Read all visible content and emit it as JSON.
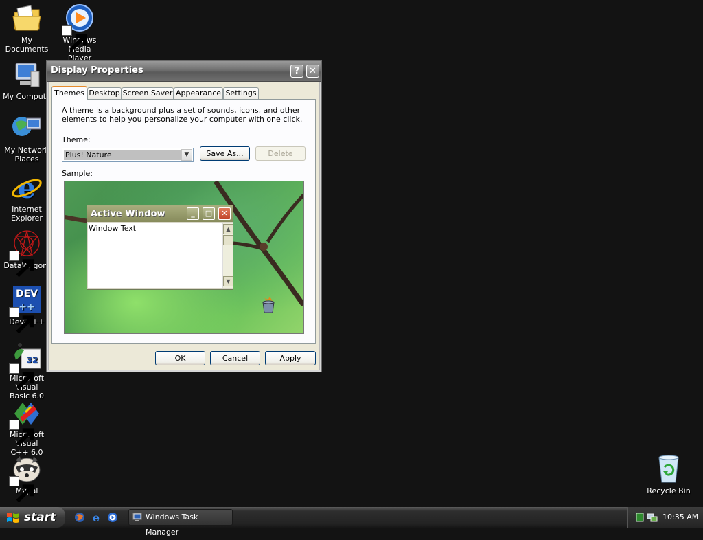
{
  "desktop": {
    "icons": [
      {
        "label": "My Documents",
        "icon": "my-documents-icon"
      },
      {
        "label": "Windows Media\nPlayer",
        "icon": "windows-media-player-icon"
      },
      {
        "label": "My Compute",
        "icon": "my-computer-icon"
      },
      {
        "label": "My Network\nPlaces",
        "icon": "my-network-places-icon"
      },
      {
        "label": "Internet\nExplorer",
        "icon": "internet-explorer-icon"
      },
      {
        "label": "DataWagon.",
        "icon": "datawagon-icon"
      },
      {
        "label": "Dev-C++",
        "icon": "dev-cpp-icon"
      },
      {
        "label": "Microsoft Visual\nBasic 6.0",
        "icon": "visual-basic-icon"
      },
      {
        "label": "Microsoft Visual\nC++ 6.0",
        "icon": "visual-cpp-icon"
      },
      {
        "label": "Mypal",
        "icon": "mypal-icon"
      },
      {
        "label": "Recycle Bin",
        "icon": "recycle-bin-icon"
      }
    ]
  },
  "dialog": {
    "title": "Display Properties",
    "help_label": "?",
    "close_label": "✕",
    "tabs": [
      "Themes",
      "Desktop",
      "Screen Saver",
      "Appearance",
      "Settings"
    ],
    "active_tab": "Themes",
    "description": "A theme is a background plus a set of sounds, icons, and other elements to help you personalize your computer with one click.",
    "theme_label": "Theme:",
    "theme_value": "Plus! Nature",
    "save_as_label": "Save As...",
    "delete_label": "Delete",
    "sample_label": "Sample:",
    "preview": {
      "window_title": "Active Window",
      "window_text": "Window Text"
    },
    "buttons": {
      "ok": "OK",
      "cancel": "Cancel",
      "apply": "Apply"
    }
  },
  "taskbar": {
    "start_label": "start",
    "quick_launch": [
      "firefox-icon",
      "internet-explorer-icon",
      "media-player-icon"
    ],
    "tasks": [
      {
        "label": "Windows Task Manager",
        "icon": "task-manager-icon"
      }
    ],
    "clock": "10:35 AM"
  }
}
